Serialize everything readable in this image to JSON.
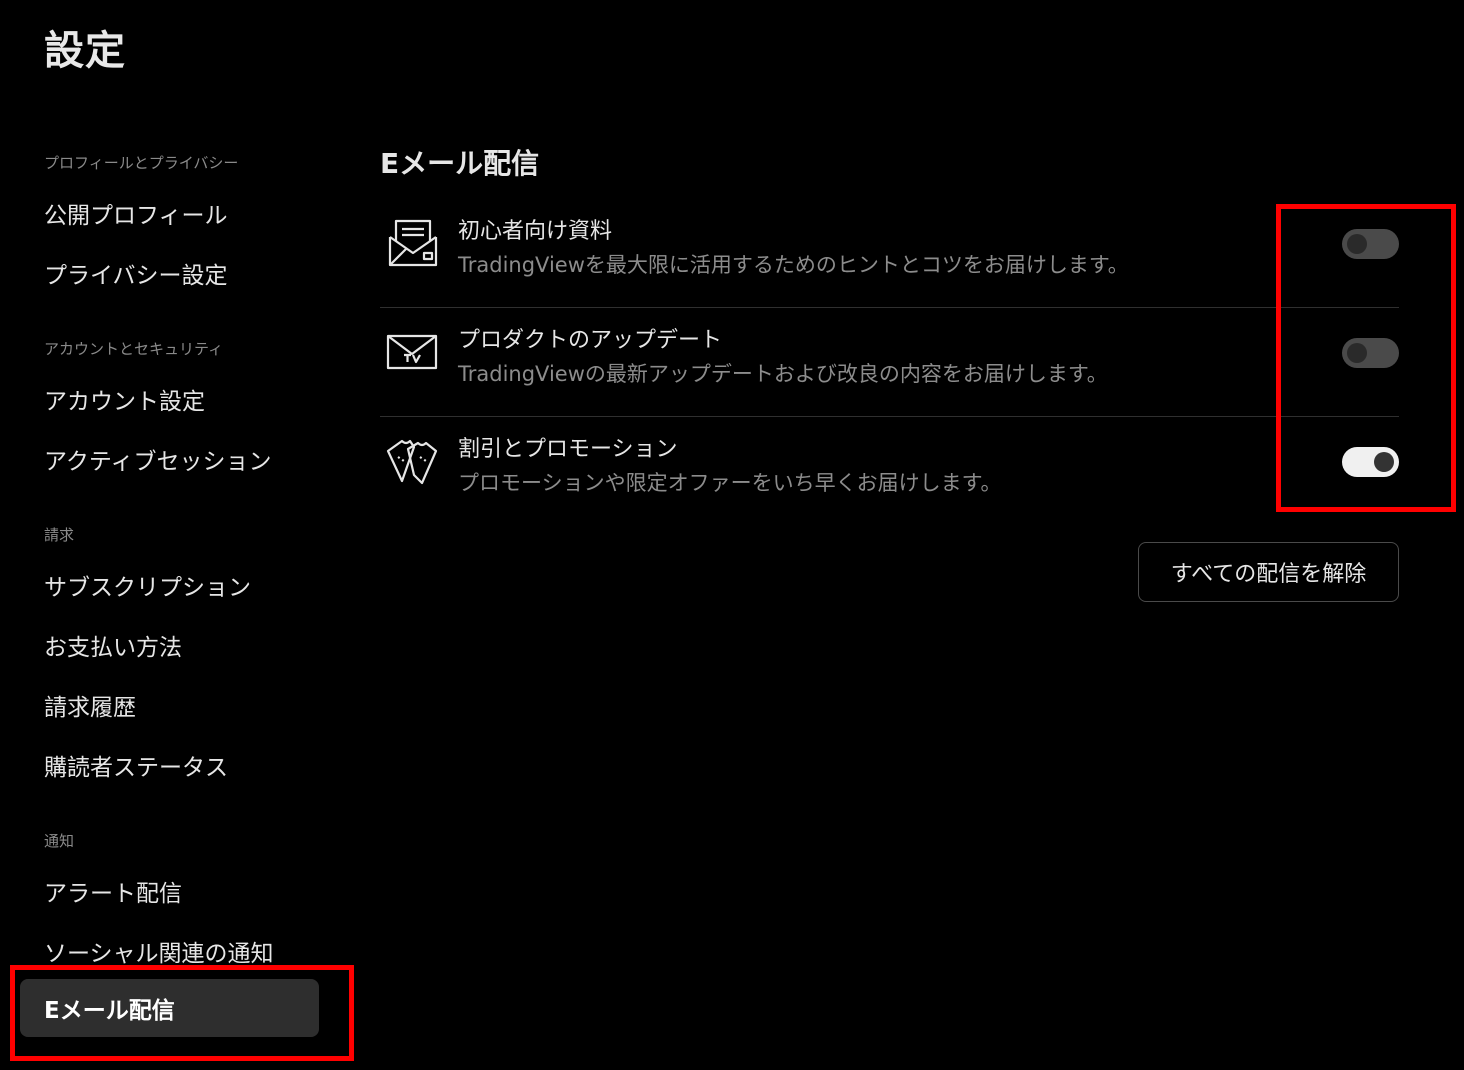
{
  "page": {
    "title": "設定"
  },
  "sidebar": {
    "sections": [
      {
        "label": "プロフィールとプライバシー",
        "items": [
          "公開プロフィール",
          "プライバシー設定"
        ]
      },
      {
        "label": "アカウントとセキュリティ",
        "items": [
          "アカウント設定",
          "アクティブセッション"
        ]
      },
      {
        "label": "請求",
        "items": [
          "サブスクリプション",
          "お支払い方法",
          "請求履歴",
          "購読者ステータス"
        ]
      },
      {
        "label": "通知",
        "items": [
          "アラート配信",
          "ソーシャル関連の通知",
          "Eメール配信"
        ]
      }
    ],
    "active_item": "Eメール配信"
  },
  "main": {
    "title": "Eメール配信",
    "subscriptions": [
      {
        "icon": "newsletter-icon",
        "title": "初心者向け資料",
        "description": "TradingViewを最大限に活用するためのヒントとコツをお届けします。",
        "enabled": false
      },
      {
        "icon": "tv-envelope-icon",
        "title": "プロダクトのアップデート",
        "description": "TradingViewの最新アップデートおよび改良の内容をお届けします。",
        "enabled": false
      },
      {
        "icon": "tickets-icon",
        "title": "割引とプロモーション",
        "description": "プロモーションや限定オファーをいち早くお届けします。",
        "enabled": true
      }
    ],
    "unsubscribe_all_label": "すべての配信を解除"
  },
  "colors": {
    "background": "#000000",
    "active_nav_bg": "#2e2e2e",
    "toggle_off": "#4a4a4a",
    "toggle_on": "#f0f0f0",
    "annotation": "#ff0000"
  }
}
